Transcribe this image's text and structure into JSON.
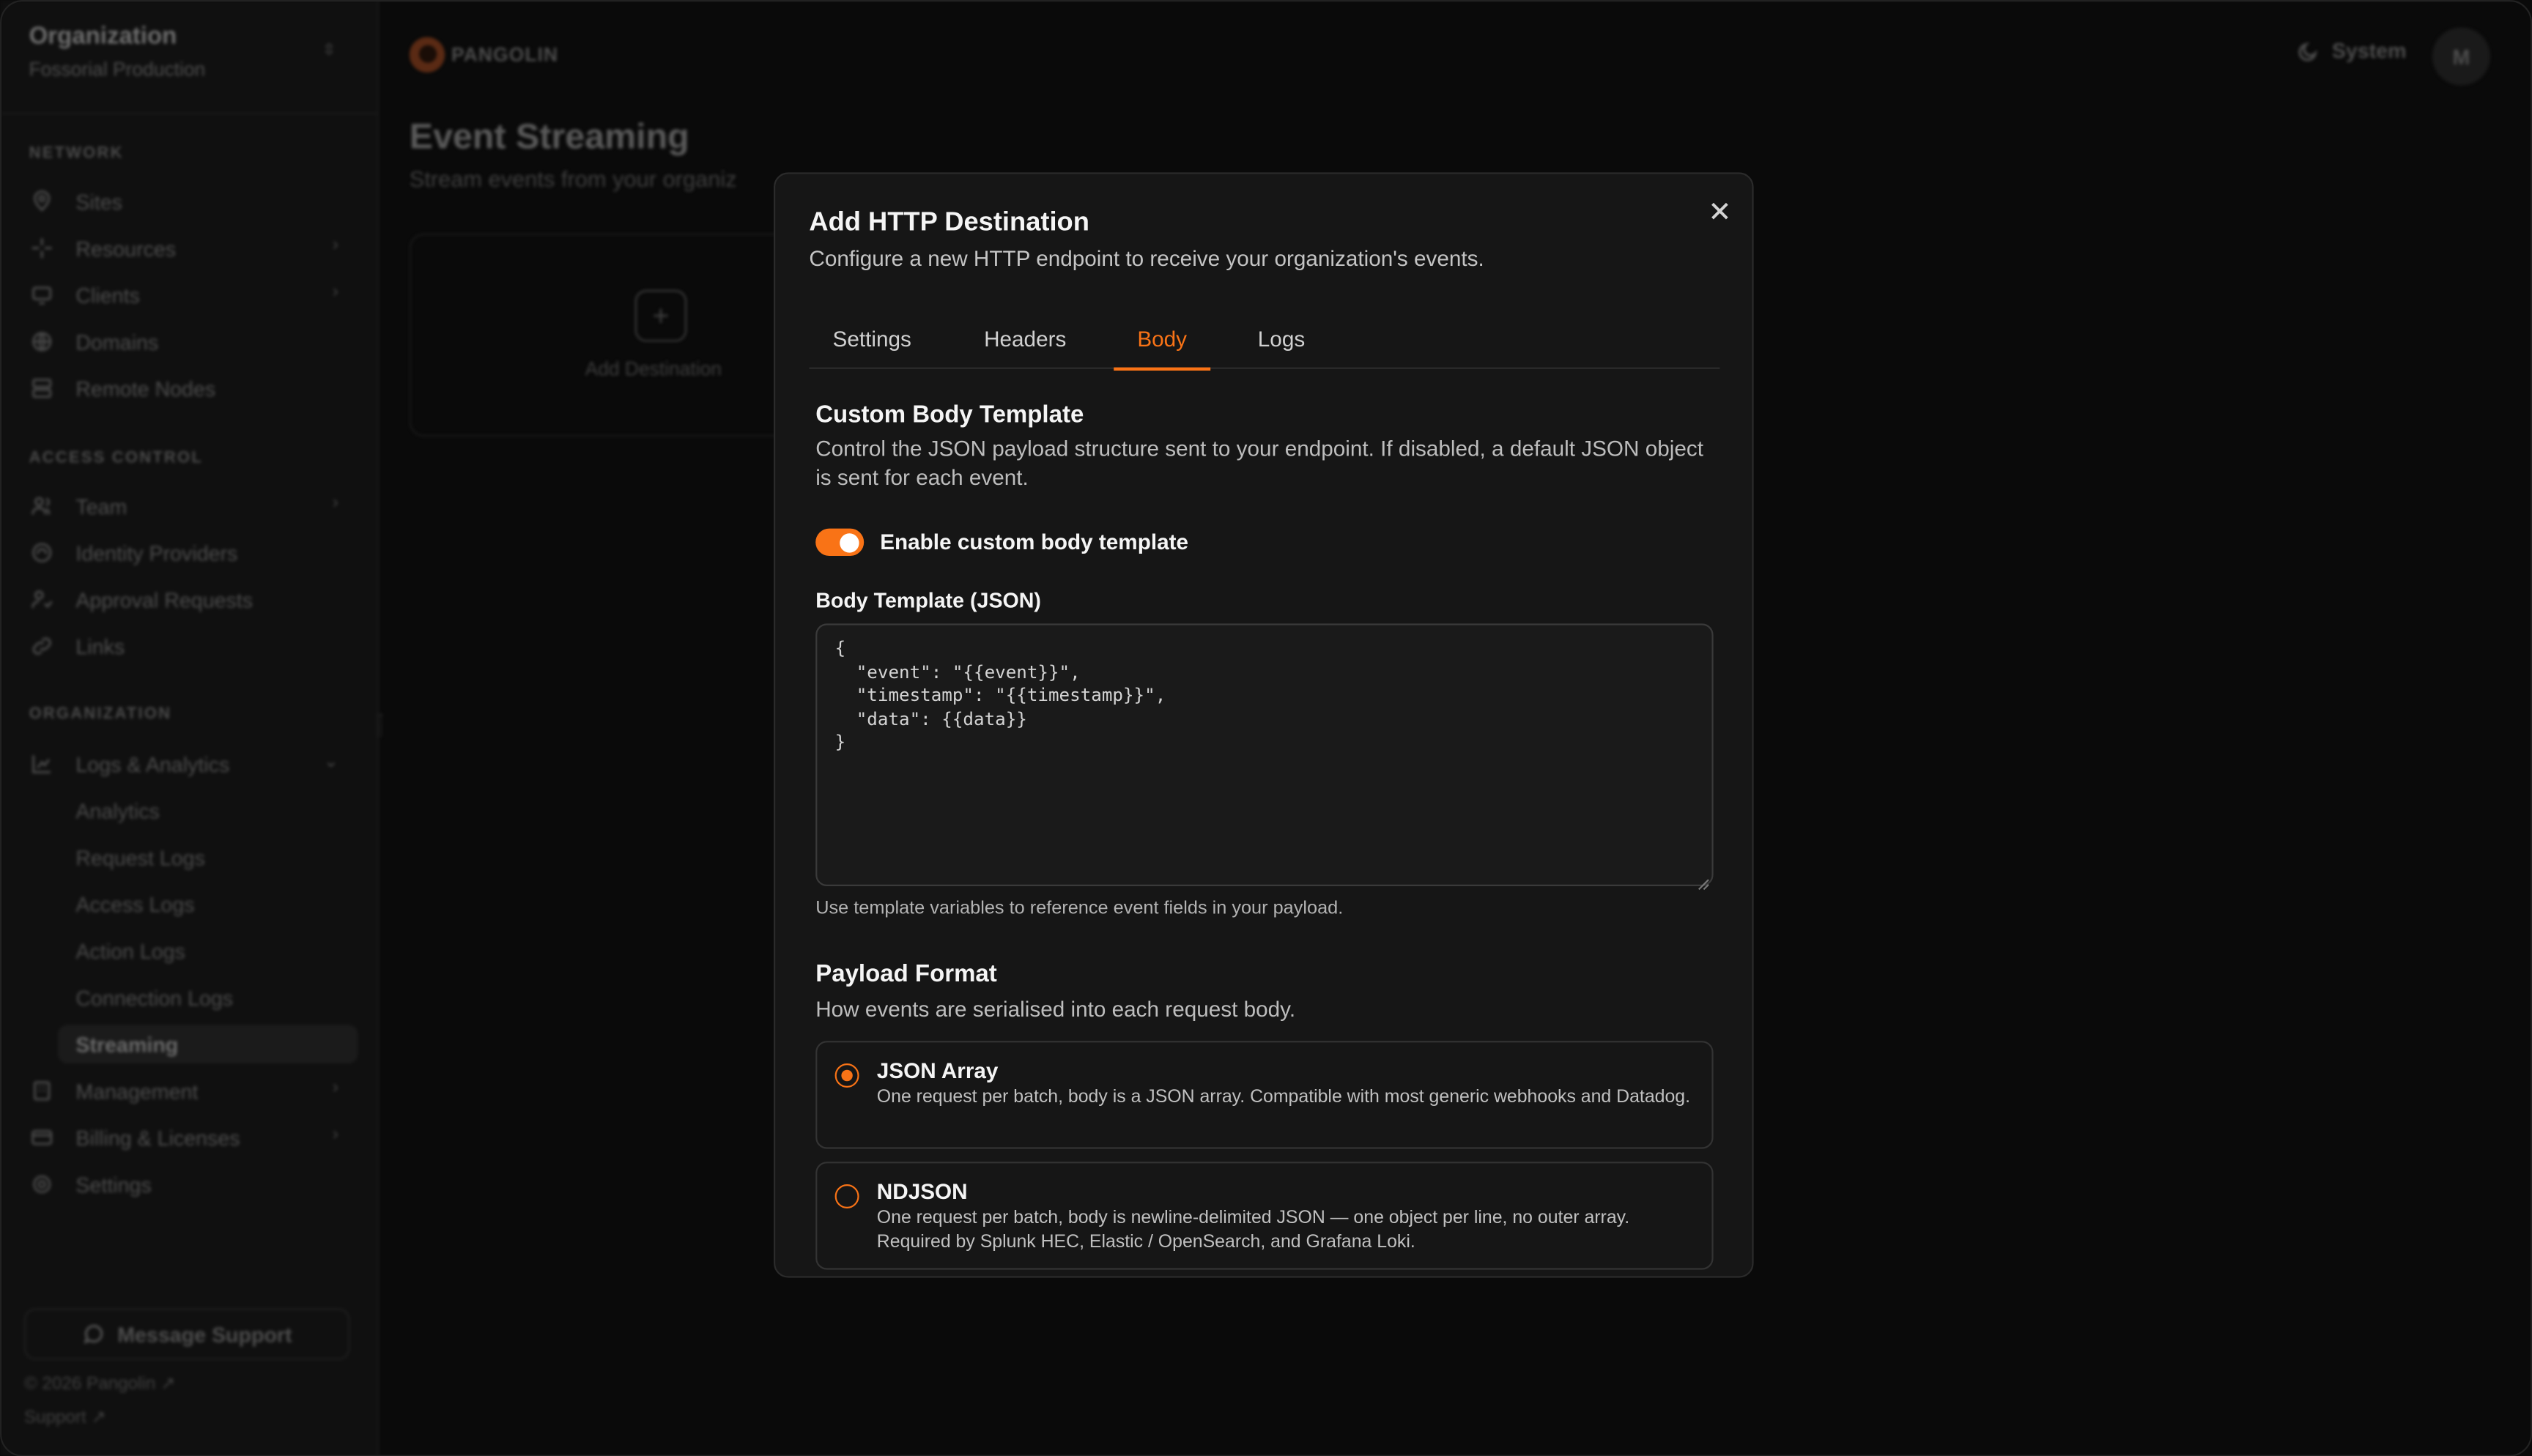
{
  "sidebar": {
    "org_title": "Organization",
    "org_name": "Fossorial Production",
    "sections": {
      "network": "NETWORK",
      "access_control": "ACCESS CONTROL",
      "organization": "ORGANIZATION"
    },
    "network_items": [
      "Sites",
      "Resources",
      "Clients",
      "Domains",
      "Remote Nodes"
    ],
    "access_items": [
      "Team",
      "Identity Providers",
      "Approval Requests",
      "Links"
    ],
    "org_items": {
      "logs": "Logs & Analytics",
      "logs_children": [
        "Analytics",
        "Request Logs",
        "Access Logs",
        "Action Logs",
        "Connection Logs",
        "Streaming"
      ],
      "after": [
        "Management",
        "Billing & Licenses",
        "Settings"
      ]
    },
    "support_label": "Message Support",
    "copyright": "© 2026 Pangolin",
    "support_link": "Support"
  },
  "header": {
    "brand": "PANGOLIN",
    "theme_label": "System",
    "avatar_initial": "M"
  },
  "page": {
    "title": "Event Streaming",
    "subtitle": "Stream events from your organiz",
    "add_destination": "Add Destination"
  },
  "dialog": {
    "title": "Add HTTP Destination",
    "subtitle": "Configure a new HTTP endpoint to receive your organization's events.",
    "tabs": [
      "Settings",
      "Headers",
      "Body",
      "Logs"
    ],
    "active_tab": "Body",
    "custom_body": {
      "title": "Custom Body Template",
      "description": "Control the JSON payload structure sent to your endpoint. If disabled, a default JSON object is sent for each event.",
      "toggle_label": "Enable custom body template",
      "toggle_on": true
    },
    "body_template": {
      "label": "Body Template (JSON)",
      "value": "{\n  \"event\": \"{{event}}\",\n  \"timestamp\": \"{{timestamp}}\",\n  \"data\": {{data}}\n}",
      "hint": "Use template variables to reference event fields in your payload."
    },
    "payload_format": {
      "title": "Payload Format",
      "description": "How events are serialised into each request body.",
      "options": [
        {
          "title": "JSON Array",
          "description": "One request per batch, body is a JSON array. Compatible with most generic webhooks and Datadog.",
          "selected": true
        },
        {
          "title": "NDJSON",
          "description": "One request per batch, body is newline-delimited JSON — one object per line, no outer array. Required by Splunk HEC, Elastic / OpenSearch, and Grafana Loki.",
          "selected": false
        }
      ]
    }
  },
  "colors": {
    "accent": "#f97316",
    "dialog_bg": "#161616",
    "page_bg": "#0a0a0a"
  }
}
